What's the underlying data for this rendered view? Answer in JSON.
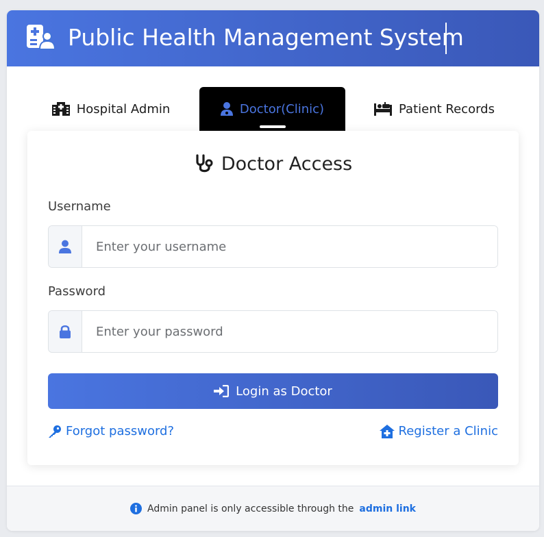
{
  "header": {
    "title": "Public Health Management System"
  },
  "tabs": [
    {
      "label": "Hospital Admin",
      "icon": "hospital-icon",
      "active": false
    },
    {
      "label": "Doctor(Clinic)",
      "icon": "user-doctor-icon",
      "active": true
    },
    {
      "label": "Patient Records",
      "icon": "bed-patient-icon",
      "active": false
    }
  ],
  "login": {
    "title": "Doctor Access",
    "username_label": "Username",
    "username_placeholder": "Enter your username",
    "password_label": "Password",
    "password_placeholder": "Enter your password",
    "submit_label": "Login as Doctor",
    "forgot_label": "Forgot password?",
    "register_label": "Register a Clinic"
  },
  "footer": {
    "text": "Admin panel is only accessible through the",
    "link_label": "admin link"
  },
  "colors": {
    "accent": "#4a75e0",
    "accent_dark": "#3a58b8",
    "link": "#1e6fe0",
    "active_tab_bg": "#000000"
  }
}
